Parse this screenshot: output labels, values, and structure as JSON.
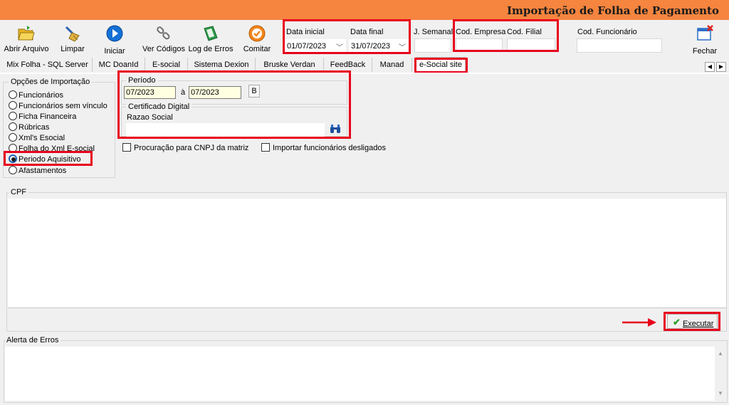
{
  "window": {
    "title": "Importação de Folha de Pagamento"
  },
  "toolbar": {
    "buttons": [
      {
        "label": "Abrir Arquivo",
        "icon": "folder-open-icon"
      },
      {
        "label": "Limpar",
        "icon": "broom-icon"
      },
      {
        "label": "Iniciar",
        "icon": "play-icon"
      },
      {
        "label": "Ver Códigos",
        "icon": "chain-link-icon"
      },
      {
        "label": "Log de Erros",
        "icon": "log-book-icon"
      },
      {
        "label": "Comitar",
        "icon": "commit-check-icon"
      },
      {
        "label": "Fechar",
        "icon": "close-window-icon"
      }
    ],
    "data_inicial": {
      "label": "Data inicial",
      "value": "01/07/2023"
    },
    "data_final": {
      "label": "Data final",
      "value": "31/07/2023"
    },
    "j_semanal": {
      "label": "J. Semanal",
      "value": ""
    },
    "cod_empresa": {
      "label": "Cod. Empresa",
      "value": ""
    },
    "cod_filial": {
      "label": "Cod. Filial",
      "value": ""
    },
    "cod_funcionario": {
      "label": "Cod. Funcionário",
      "value": ""
    }
  },
  "tabs": [
    {
      "label": "Mix Folha - SQL Server"
    },
    {
      "label": "MC DoanId"
    },
    {
      "label": "E-social"
    },
    {
      "label": "Sistema Dexion"
    },
    {
      "label": "Bruske Verdan"
    },
    {
      "label": "FeedBack"
    },
    {
      "label": "Manad"
    },
    {
      "label": "e-Social site"
    }
  ],
  "active_tab": "e-Social site",
  "options": {
    "title": "Opções de Importação",
    "items": [
      {
        "label": "Funcionários",
        "selected": false
      },
      {
        "label": "Funcionários sem vínculo",
        "selected": false
      },
      {
        "label": "Ficha Financeira",
        "selected": false
      },
      {
        "label": "Rúbricas",
        "selected": false
      },
      {
        "label": "Xml's Esocial",
        "selected": false
      },
      {
        "label": "Folha do Xml E-social",
        "selected": false
      },
      {
        "label": "Periodo Aquisitivo",
        "selected": true
      },
      {
        "label": "Afastamentos",
        "selected": false
      }
    ]
  },
  "periodo": {
    "title": "Período",
    "from": "07/2023",
    "separator": "à",
    "to": "07/2023",
    "b_button": "B"
  },
  "certificado": {
    "title": "Certificado Digital",
    "razao_label": "Razao Social",
    "razao_value": ""
  },
  "checkboxes": {
    "procuracao": "Procuração para CNPJ da matriz",
    "desligados": "Importar funcionários desligados"
  },
  "cpf": {
    "title": "CPF"
  },
  "executar": {
    "label": "Executar"
  },
  "alerta": {
    "title": "Alerta de Erros"
  },
  "colors": {
    "titlebar": "#f5853f",
    "highlight": "#e8001c",
    "input_yellow": "#ffffe1"
  }
}
